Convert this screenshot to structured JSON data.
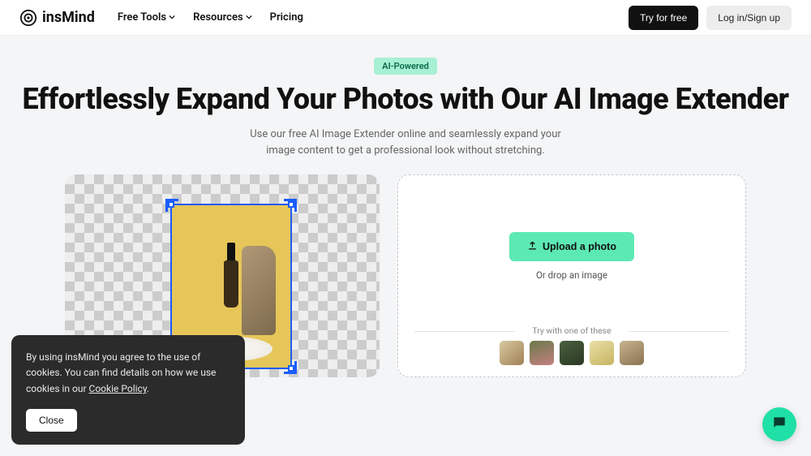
{
  "brand": {
    "name": "insMind"
  },
  "nav": {
    "free_tools": "Free Tools",
    "resources": "Resources",
    "pricing": "Pricing"
  },
  "header_cta": {
    "try": "Try for free",
    "login": "Log in/Sign up"
  },
  "hero": {
    "badge": "AI-Powered",
    "title": "Effortlessly Expand Your Photos with Our AI Image Extender",
    "subtitle": "Use our free AI Image Extender online and seamlessly expand your image content to get a professional look without stretching."
  },
  "upload": {
    "button": "Upload a photo",
    "drop": "Or drop an image",
    "try_label": "Try with one of these"
  },
  "cookie": {
    "line1": "By using insMind you agree to the use of cookies.",
    "line2_prefix": "You can find details on how we use cookies in our ",
    "policy_link": "Cookie Policy",
    "line2_suffix": ".",
    "close": "Close"
  },
  "icons": {
    "chevron_down": "chevron-down-icon",
    "upload": "upload-icon",
    "chat": "chat-icon",
    "logo": "logo-icon"
  }
}
